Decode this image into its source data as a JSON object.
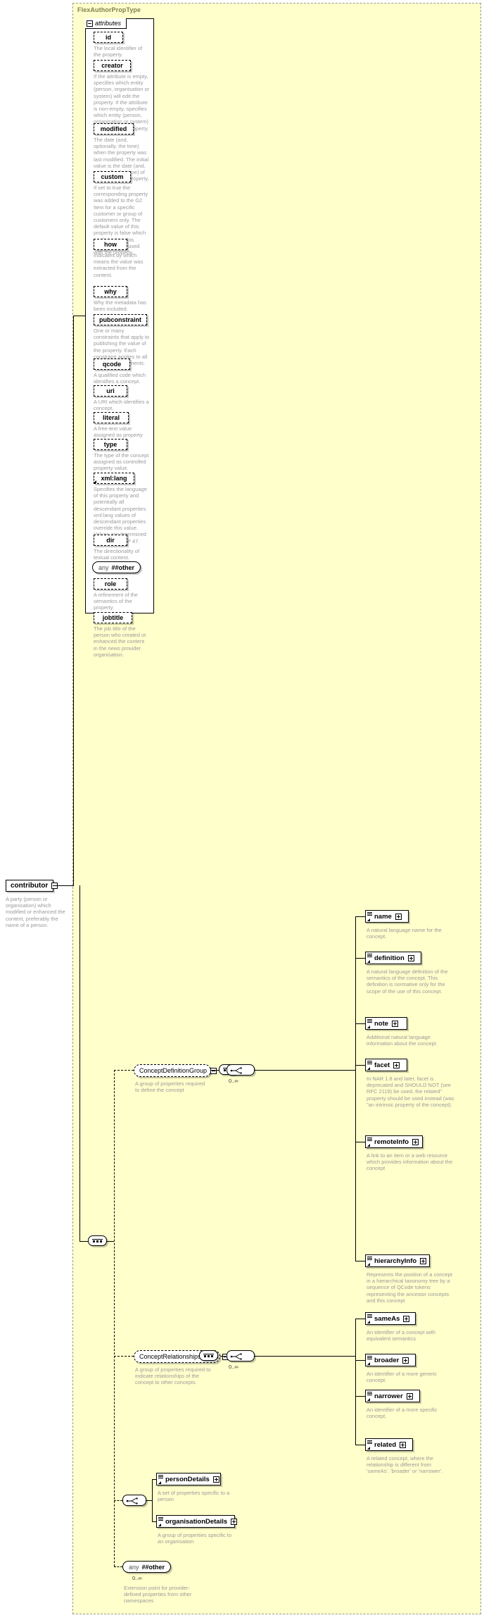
{
  "diagram": {
    "type_name": "FlexAuthorPropType",
    "attributes_label": "attributes",
    "root_element": {
      "name": "contributor",
      "desc": "A party (person or organisation) which modified or enhanced the content, preferably the name of a person."
    },
    "attributes": [
      {
        "name": "id",
        "desc": "The local identifier of the property."
      },
      {
        "name": "creator",
        "desc": "If the attribute is empty, specifies which entity (person, organisation or system) will edit the property. If the attribute is non-empty, specifies which entity (person, organisation or system) has edited the property."
      },
      {
        "name": "modified",
        "desc": "The date (and, optionally, the time) when the property was last modified. The initial value is the date (and, optionally, the time) of creation of the property."
      },
      {
        "name": "custom",
        "desc": "If set to true the corresponding property was added to the G2 Item for a specific customer or group of customers only. The default value of this property is false which applies when this attribute is not used with the property."
      },
      {
        "name": "how",
        "desc": "Indicates by which means the value was extracted from the content."
      },
      {
        "name": "why",
        "desc": "Why the metadata has been included."
      },
      {
        "name": "pubconstraint",
        "desc": "One or many constraints that apply to publishing the value of the property. Each constraint applies to all descendant elements."
      },
      {
        "name": "qcode",
        "desc": "A qualified code which identifies a concept."
      },
      {
        "name": "uri",
        "desc": "A URI which identifies a concept."
      },
      {
        "name": "literal",
        "desc": "A free-text value assigned as property value."
      },
      {
        "name": "type",
        "desc": "The type of the concept assigned as controlled property value."
      },
      {
        "name": "xml:lang",
        "desc": "Specifies the language of this property and potentially all descendant properties. xml:lang values of descendant properties override this value. Values are determined by Internet BCP 47."
      },
      {
        "name": "dir",
        "desc": "The directionality of textual content."
      }
    ],
    "any_attribute": {
      "any": "any",
      "namespace": "##other"
    },
    "attributes_tail": [
      {
        "name": "role",
        "desc": "A refinement of the semantics of the property."
      },
      {
        "name": "jobtitle",
        "desc": "The job title of the person who created or enhanced the content in the news provider organisation."
      }
    ],
    "groups": [
      {
        "name": "ConceptDefinitionGroup",
        "desc": "A group of properites required to define the concept",
        "cardinality": "0..∞",
        "children": [
          {
            "name": "name",
            "desc": "A natural language name for the concept."
          },
          {
            "name": "definition",
            "desc": "A natural language definition of the semantics of the concept. This definition is normative only for the scope of the use of this concept."
          },
          {
            "name": "note",
            "desc": "Additional natural language information about the concept."
          },
          {
            "name": "facet",
            "desc": "In NAR 1.8 and later, facet is deprecated and SHOULD NOT (see RFC 2119) be used, the related\" property should be used instead (was \"an intrinsic property of the concept)."
          },
          {
            "name": "remoteInfo",
            "desc": "A link to an item or a web resource which provides information about the concept"
          },
          {
            "name": "hierarchyInfo",
            "desc": "Represents the position of a concept in a hierarchical taxonomy tree by a sequence of QCode tokens representing the ancestor concepts and this concept"
          }
        ]
      },
      {
        "name": "ConceptRelationshipsGroup",
        "desc": "A group of properties required to indicate relationships of the concept to other concepts",
        "cardinality": "0..∞",
        "children": [
          {
            "name": "sameAs",
            "desc": "An identifier of a concept with equivalent semantics"
          },
          {
            "name": "broader",
            "desc": "An identifier of a more generic concept."
          },
          {
            "name": "narrower",
            "desc": "An identifier of a more specific concept."
          },
          {
            "name": "related",
            "desc": "A related concept, where the relationship is different from 'sameAs', 'broader' or 'narrower'."
          }
        ]
      }
    ],
    "detail_choice": [
      {
        "name": "personDetails",
        "desc": "A set of properties specific to a person"
      },
      {
        "name": "organisationDetails",
        "desc": "A group of properties specific to an organisation"
      }
    ],
    "any_element": {
      "any": "any",
      "namespace": "##other",
      "cardinality": "0..∞",
      "desc": "Extension point for provider-defined properties from other namespaces"
    }
  }
}
